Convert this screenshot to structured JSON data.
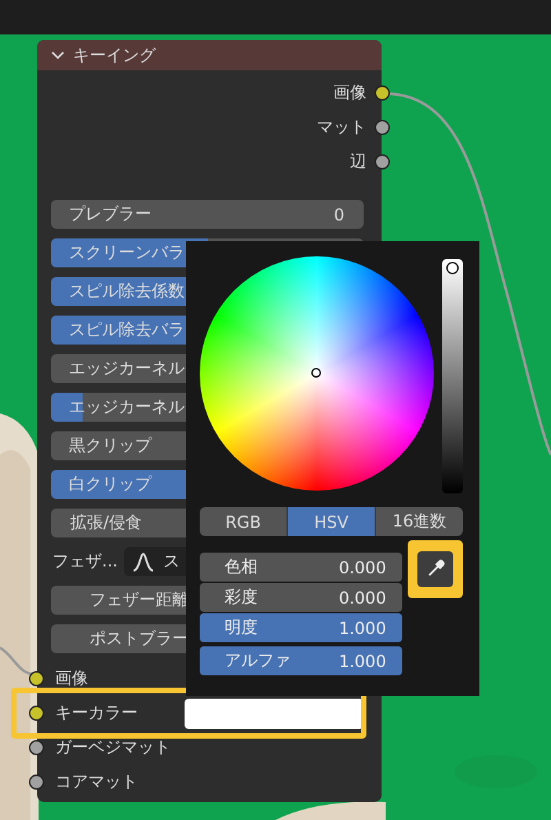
{
  "node": {
    "title": "キーイング",
    "expanded": true,
    "outputs": [
      {
        "label": "画像",
        "color": "#c7c229"
      },
      {
        "label": "マット",
        "color": "#a1a1a1"
      },
      {
        "label": "辺",
        "color": "#a1a1a1"
      }
    ],
    "controls": [
      {
        "kind": "slider",
        "label": "プレブラー",
        "value": "0",
        "level": 0
      },
      {
        "kind": "slider",
        "label": "スクリーンバラ",
        "level": 0.5
      },
      {
        "kind": "slider",
        "label": "スピル除去係数",
        "level": 1
      },
      {
        "kind": "slider",
        "label": "スピル除去バラ",
        "level": 0.5
      },
      {
        "kind": "slider",
        "label": "エッジカーネル",
        "level": 0
      },
      {
        "kind": "slider",
        "label": "エッジカーネル",
        "level": 0.1
      },
      {
        "kind": "slider",
        "label": "黒クリップ",
        "level": 0
      },
      {
        "kind": "slider",
        "label": "白クリップ",
        "level": 1
      },
      {
        "kind": "button",
        "label": "拡張/侵食"
      },
      {
        "kind": "dropdown",
        "label": "フェザ...",
        "value": "ス"
      },
      {
        "kind": "button",
        "label": "フェザー距離"
      },
      {
        "kind": "button",
        "label": "ポストブラー"
      }
    ],
    "inputs": [
      {
        "label": "画像",
        "color": "#c7c229",
        "highlighted": false,
        "swatch": false
      },
      {
        "label": "キーカラー",
        "color": "#c7c229",
        "highlighted": true,
        "swatch": true
      },
      {
        "label": "ガーベジマット",
        "color": "#a1a1a1",
        "highlighted": false,
        "swatch": false
      },
      {
        "label": "コアマット",
        "color": "#a1a1a1",
        "highlighted": false,
        "swatch": false
      }
    ]
  },
  "color_picker": {
    "value_slider": {
      "level": 1
    },
    "modes": [
      {
        "label": "RGB",
        "selected": false
      },
      {
        "label": "HSV",
        "selected": true
      },
      {
        "label": "16進数",
        "selected": false
      }
    ],
    "eyedropper_highlighted": true,
    "fields": [
      {
        "label": "色相",
        "value": "0.000",
        "level": 0
      },
      {
        "label": "彩度",
        "value": "0.000",
        "level": 0
      },
      {
        "label": "明度",
        "value": "1.000",
        "level": 1
      },
      {
        "label": "アルファ",
        "value": "1.000",
        "level": 1
      }
    ]
  }
}
